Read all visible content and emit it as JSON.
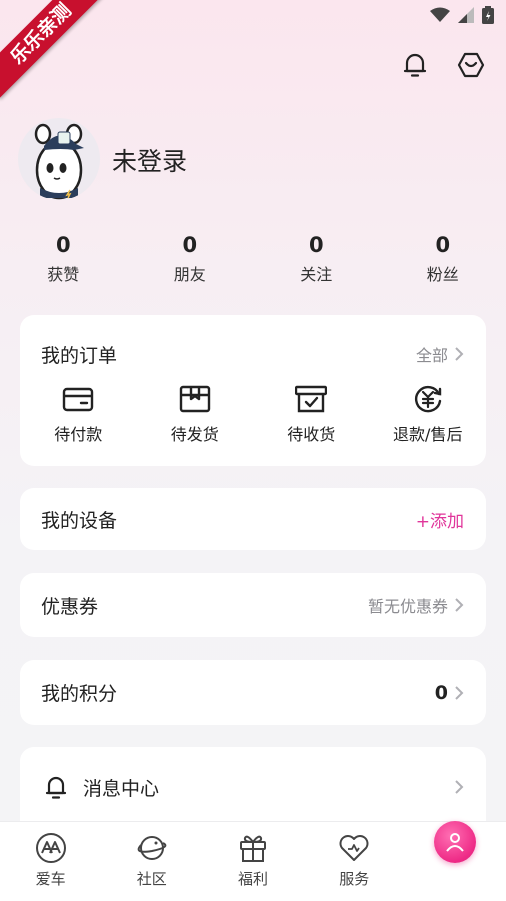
{
  "ribbon": {
    "text": "乐乐亲测"
  },
  "profile": {
    "username": "未登录"
  },
  "stats": [
    {
      "value": "0",
      "label": "获赞"
    },
    {
      "value": "0",
      "label": "朋友"
    },
    {
      "value": "0",
      "label": "关注"
    },
    {
      "value": "0",
      "label": "粉丝"
    }
  ],
  "orders": {
    "title": "我的订单",
    "all_label": "全部",
    "items": [
      {
        "label": "待付款",
        "icon": "wallet-icon"
      },
      {
        "label": "待发货",
        "icon": "package-icon"
      },
      {
        "label": "待收货",
        "icon": "receive-box-icon"
      },
      {
        "label": "退款/售后",
        "icon": "refund-icon"
      }
    ]
  },
  "device": {
    "title": "我的设备",
    "add_label": "+添加"
  },
  "coupon": {
    "title": "优惠券",
    "status": "暂无优惠券"
  },
  "points": {
    "title": "我的积分",
    "value": "0"
  },
  "messages": {
    "title": "消息中心"
  },
  "tabbar": [
    {
      "label": "爱车",
      "icon": "car-logo-icon"
    },
    {
      "label": "社区",
      "icon": "planet-icon"
    },
    {
      "label": "福利",
      "icon": "gift-icon"
    },
    {
      "label": "服务",
      "icon": "heart-icon"
    }
  ],
  "colors": {
    "accent": "#e0359a",
    "ribbon": "#c8102e"
  }
}
